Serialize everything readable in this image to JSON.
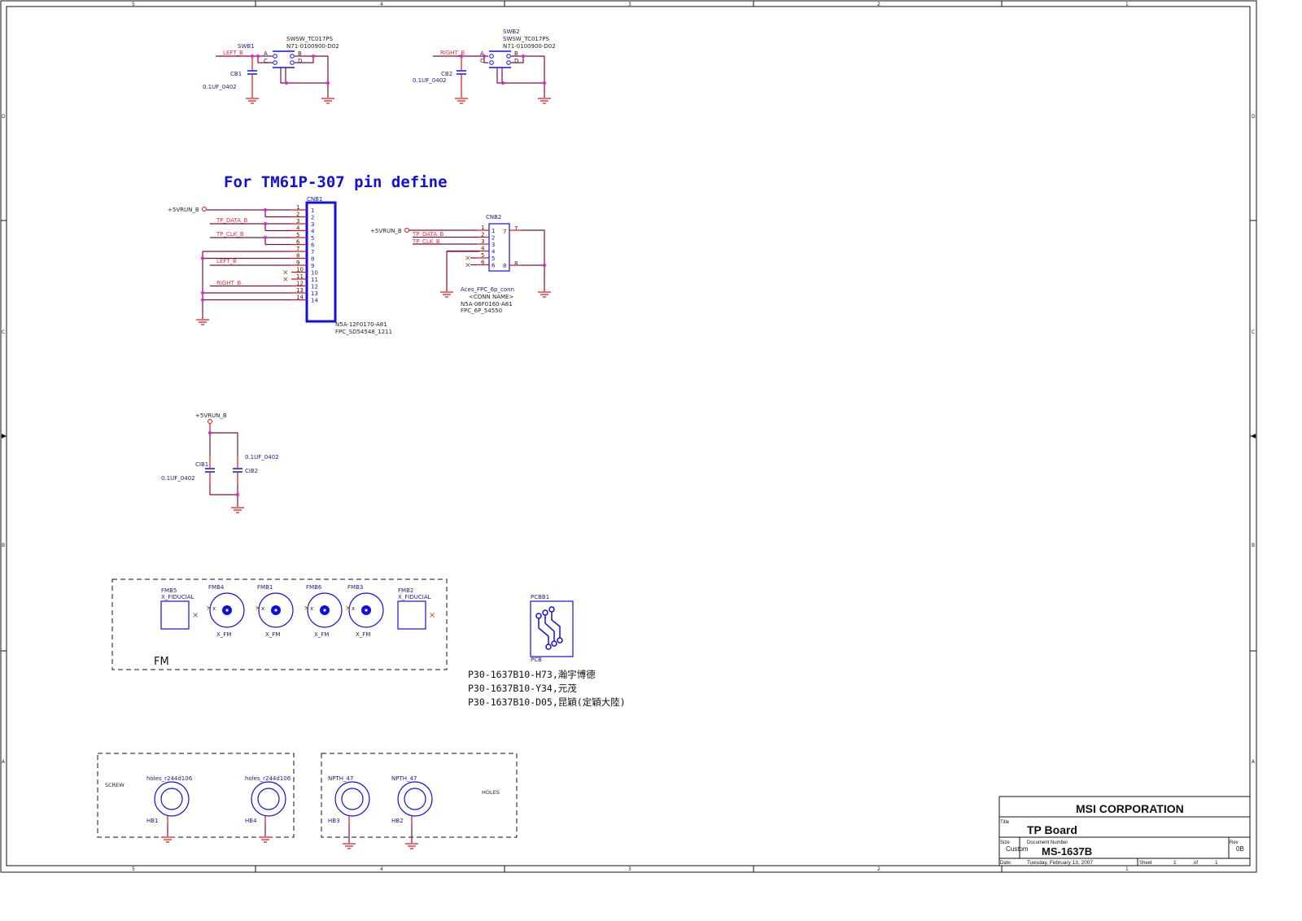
{
  "sheet": {
    "heading": "For TM61P-307 pin define",
    "column_markers": [
      "5",
      "4",
      "3",
      "2",
      "1"
    ],
    "row_markers": [
      "D",
      "C",
      "B",
      "A"
    ]
  },
  "switches": [
    {
      "ref": "SWB1",
      "part": "SWSW_TC017PS",
      "pn": "N71-0100900-D02",
      "net": "LEFT_B",
      "cap_ref": "CB1",
      "cap_val": "0.1UF_0402",
      "pins": [
        "A",
        "B",
        "C",
        "D"
      ]
    },
    {
      "ref": "SWB2",
      "part": "SWSW_TC017PS",
      "pn": "N71-0100900-D02",
      "net": "RIGHT_B",
      "cap_ref": "CB2",
      "cap_val": "0.1UF_0402",
      "pins": [
        "A",
        "B",
        "C",
        "D"
      ]
    }
  ],
  "cnb1": {
    "ref": "CNB1",
    "power_net": "+5VRUN_B",
    "nets": {
      "data": "TP_DATA_B",
      "clk": "TP_CLK_B",
      "left": "LEFT_B",
      "right": "RIGHT_B"
    },
    "pins": [
      "1",
      "2",
      "3",
      "4",
      "5",
      "6",
      "7",
      "8",
      "9",
      "10",
      "11",
      "12",
      "13",
      "14"
    ],
    "pn": "N5A-12F0170-A81",
    "footprint": "FPC_SD54548_1211"
  },
  "cnb2": {
    "ref": "CNB2",
    "power_net": "+5VRUN_B",
    "nets": {
      "data": "TP_DATA_B",
      "clk": "TP_CLK_B"
    },
    "pins": [
      "1",
      "2",
      "3",
      "4",
      "5",
      "6"
    ],
    "extra_pins": [
      "7",
      "8"
    ],
    "part": "Aces_FPC_6p_conn",
    "conn_name": "<CONN NAME>",
    "pn": "N5A-06F0160-A81",
    "footprint": "FPC_6P_54550"
  },
  "decoupling": {
    "net": "+5VRUN_B",
    "caps": [
      {
        "ref": "CIB1",
        "val": "0.1UF_0402"
      },
      {
        "ref": "CIB2",
        "val": "0.1UF_0402"
      }
    ]
  },
  "fiducials": {
    "group_label": "FM",
    "items": [
      {
        "ref": "FMB5",
        "type": "X_FIDUCIAL"
      },
      {
        "ref": "FMB4",
        "type": "X_FM"
      },
      {
        "ref": "FMB1",
        "type": "X_FM"
      },
      {
        "ref": "FMB6",
        "type": "X_FM"
      },
      {
        "ref": "FMB3",
        "type": "X_FM"
      },
      {
        "ref": "FMB2",
        "type": "X_FIDUCIAL"
      }
    ]
  },
  "pcb": {
    "ref": "PCBB1",
    "type": "PCB"
  },
  "notes": [
    "P30-1637B10-H73,瀚宇博德",
    "P30-1637B10-Y34,元茂",
    "P30-1637B10-D05,昆穎(定穎大陸)"
  ],
  "screw_group": {
    "label": "SCREW",
    "holes": [
      {
        "ref": "HB1",
        "type": "holes_r244d106"
      },
      {
        "ref": "HB4",
        "type": "holes_r244d106"
      }
    ]
  },
  "holes_group": {
    "label": "HOLES",
    "holes": [
      {
        "ref": "HB3",
        "type": "NPTH_47"
      },
      {
        "ref": "HB2",
        "type": "NPTH_47"
      }
    ]
  },
  "title_block": {
    "company": "MSI CORPORATION",
    "title_label": "Title",
    "title": "TP Board",
    "size_label": "Size",
    "size": "Custom",
    "docnum_label": "Document Number",
    "docnum": "MS-1637B",
    "rev_label": "Rev",
    "rev": "0B",
    "date_label": "Date:",
    "date": "Tuesday, February 13, 2007",
    "sheet_label": "Sheet",
    "sheet": "1",
    "of_label": "of",
    "of": "1"
  }
}
